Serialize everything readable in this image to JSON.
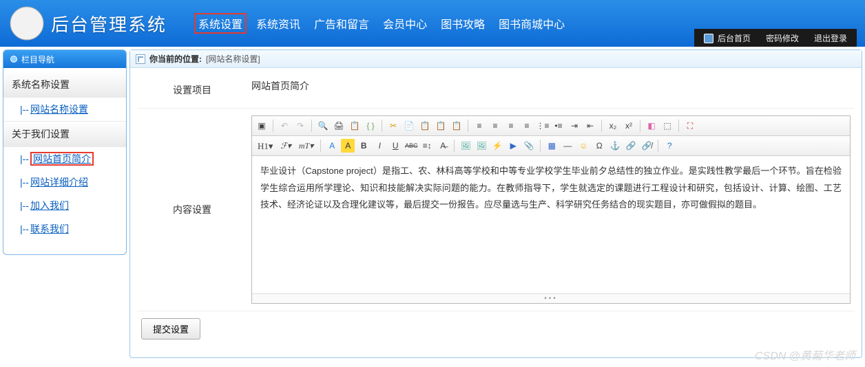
{
  "header": {
    "title": "后台管理系统",
    "nav": [
      "系统设置",
      "系统资讯",
      "广告和留言",
      "会员中心",
      "图书攻略",
      "图书商城中心"
    ],
    "nav_selected_index": 0,
    "userbar": {
      "home": "后台首页",
      "pwd": "密码修改",
      "logout": "退出登录"
    }
  },
  "sidebar": {
    "heading": "栏目导航",
    "groups": [
      {
        "title": "系统名称设置",
        "items": [
          {
            "label": "网站名称设置",
            "selected": false
          }
        ]
      },
      {
        "title": "关于我们设置",
        "items": [
          {
            "label": "网站首页简介",
            "selected": true
          },
          {
            "label": "网站详细介绍",
            "selected": false
          },
          {
            "label": "加入我们",
            "selected": false
          },
          {
            "label": "联系我们",
            "selected": false
          }
        ]
      }
    ]
  },
  "crumb": {
    "label": "你当前的位置:",
    "location": "[网站名称设置]"
  },
  "form": {
    "field1_label": "设置项目",
    "field1_value": "网站首页简介",
    "field2_label": "内容设置",
    "editor_text": "毕业设计（Capstone project）是指工、农、林科高等学校和中等专业学校学生毕业前夕总结性的独立作业。是实践性教学最后一个环节。旨在检验学生综合运用所学理论、知识和技能解决实际问题的能力。在教师指导下，学生就选定的课题进行工程设计和研究，包括设计、计算、绘图、工艺技术、经济论证以及合理化建议等，最后提交一份报告。应尽量选与生产、科学研究任务结合的现实题目，亦可做假拟的题目。",
    "submit_label": "提交设置"
  },
  "watermark": "CSDN @黄菊华老师",
  "toolbar_row1": [
    {
      "n": "source-icon",
      "t": "▣"
    },
    {
      "sep": true
    },
    {
      "n": "undo-icon",
      "t": "↶",
      "d": true
    },
    {
      "n": "redo-icon",
      "t": "↷",
      "d": true
    },
    {
      "sep": true
    },
    {
      "n": "preview-icon",
      "t": "🔍"
    },
    {
      "n": "print-icon",
      "t": "🖨"
    },
    {
      "n": "template-icon",
      "t": "📋"
    },
    {
      "n": "code-icon",
      "t": "{ }",
      "c": "#7a6"
    },
    {
      "sep": true
    },
    {
      "n": "cut-icon",
      "t": "✂",
      "c": "#d90"
    },
    {
      "n": "copy-icon",
      "t": "📄"
    },
    {
      "n": "paste-icon",
      "t": "📋"
    },
    {
      "n": "paste-text-icon",
      "t": "📋"
    },
    {
      "n": "paste-word-icon",
      "t": "📋"
    },
    {
      "sep": true
    },
    {
      "n": "align-left-icon",
      "t": "≡"
    },
    {
      "n": "align-center-icon",
      "t": "≡"
    },
    {
      "n": "align-right-icon",
      "t": "≡"
    },
    {
      "n": "align-justify-icon",
      "t": "≡"
    },
    {
      "n": "list-ol-icon",
      "t": "⋮≡"
    },
    {
      "n": "list-ul-icon",
      "t": "•≡"
    },
    {
      "n": "indent-icon",
      "t": "⇥"
    },
    {
      "n": "outdent-icon",
      "t": "⇤"
    },
    {
      "sep": true
    },
    {
      "n": "subscript-icon",
      "t": "x₂"
    },
    {
      "n": "superscript-icon",
      "t": "x²"
    },
    {
      "sep": true
    },
    {
      "n": "eraser-icon",
      "t": "◧",
      "c": "#d6a"
    },
    {
      "n": "select-all-icon",
      "t": "⬚"
    },
    {
      "sep": true
    },
    {
      "n": "fullscreen-icon",
      "t": "⛶",
      "c": "#c33"
    }
  ],
  "toolbar_row2": [
    {
      "n": "heading-select",
      "t": "H1▾",
      "cls": "wide h1"
    },
    {
      "n": "font-family-select",
      "t": "ℱ▾",
      "cls": "wide"
    },
    {
      "n": "font-size-select",
      "t": "тT▾",
      "cls": "wide"
    },
    {
      "sep": true
    },
    {
      "n": "font-color-icon",
      "t": "A",
      "cls": "blue-a"
    },
    {
      "n": "highlight-icon",
      "t": "A",
      "cls": "yellow"
    },
    {
      "n": "bold-icon",
      "t": "B",
      "b": true
    },
    {
      "n": "italic-icon",
      "t": "I",
      "i": true
    },
    {
      "n": "underline-icon",
      "t": "U",
      "u": true
    },
    {
      "n": "strikethrough-icon",
      "t": "ABC",
      "s": true
    },
    {
      "n": "line-height-icon",
      "t": "≡↕"
    },
    {
      "n": "remove-format-icon",
      "t": "A̶"
    },
    {
      "sep": true
    },
    {
      "n": "image-icon",
      "t": "🖼",
      "c": "#4a9"
    },
    {
      "n": "multi-image-icon",
      "t": "🖼",
      "c": "#4a9"
    },
    {
      "n": "flash-icon",
      "t": "⚡",
      "c": "#c33"
    },
    {
      "n": "media-icon",
      "t": "▶",
      "c": "#36c"
    },
    {
      "n": "file-icon",
      "t": "📎"
    },
    {
      "sep": true
    },
    {
      "n": "table-icon",
      "t": "▦",
      "c": "#36c"
    },
    {
      "n": "hr-icon",
      "t": "—"
    },
    {
      "n": "emoji-icon",
      "t": "☺",
      "c": "#fa0"
    },
    {
      "n": "special-char-icon",
      "t": "Ω"
    },
    {
      "n": "anchor-icon",
      "t": "⚓",
      "c": "#888"
    },
    {
      "n": "link-icon",
      "t": "🔗"
    },
    {
      "n": "unlink-icon",
      "t": "🔗̸"
    },
    {
      "sep": true
    },
    {
      "n": "about-icon",
      "t": "?",
      "c": "#27b"
    }
  ]
}
